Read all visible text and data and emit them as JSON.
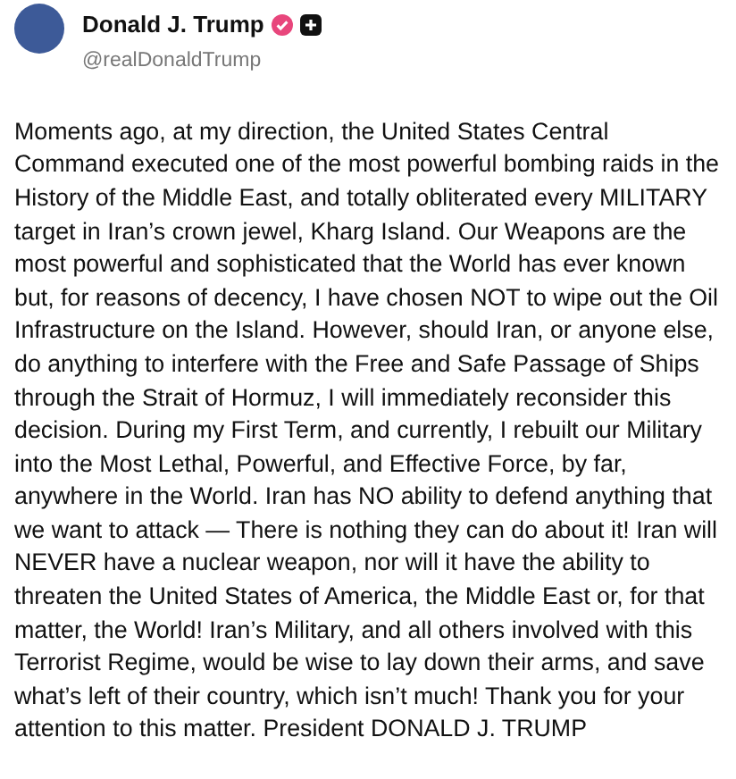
{
  "post": {
    "author": {
      "name": "Donald J. Trump",
      "handle": "@realDonaldTrump",
      "verified": true
    },
    "text": "Moments ago, at my direction, the United States Central Command executed one of the most powerful bombing raids in the History of the Middle East, and totally obliterated every MILITARY target in Iran’s crown jewel, Kharg Island. Our Weapons are the most powerful and sophisticated that the World has ever known but, for reasons of decency, I have chosen NOT to wipe out the Oil Infrastructure on the Island. However, should Iran, or anyone else, do anything to interfere with the Free and Safe Passage of Ships through the Strait of Hormuz, I will immediately reconsider this decision. During my First Term, and currently, I rebuilt our Military into the Most Lethal, Powerful, and Effective Force, by far, anywhere in the World. Iran has NO ability to defend anything that we want to attack — There is nothing they can do about it! Iran will NEVER have a nuclear weapon, nor will it have the ability to threaten the United States of America, the Middle East or, for that matter, the World! Iran’s Military, and all others involved with this Terrorist Regime, would be wise to lay down their arms, and save what’s left of their country, which isn’t much! Thank you for your attention to this matter. President DONALD J. TRUMP"
  }
}
